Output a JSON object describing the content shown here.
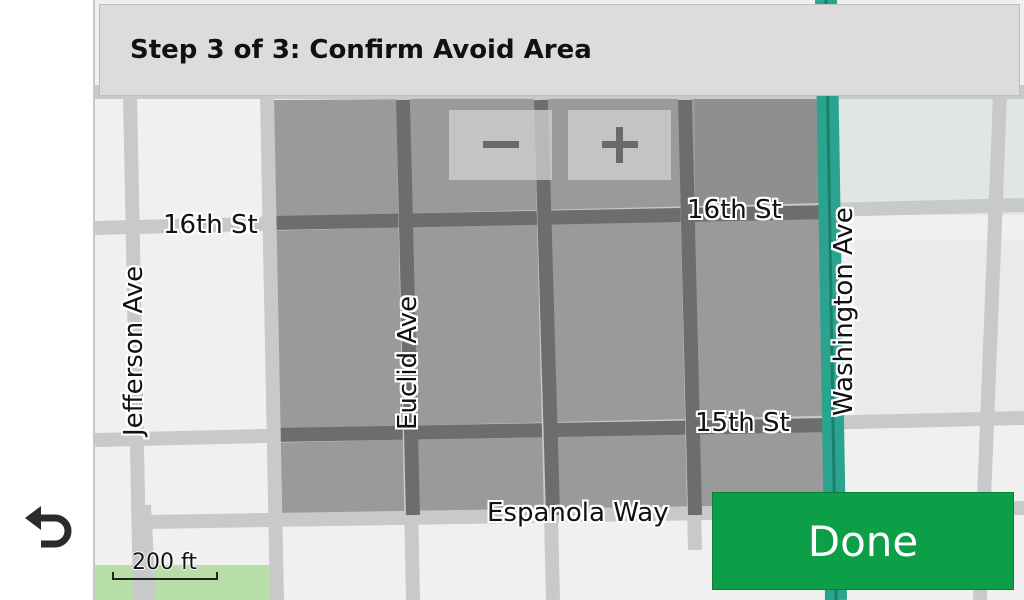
{
  "header": {
    "title": "Step 3 of 3: Confirm Avoid Area"
  },
  "map": {
    "streets": {
      "sixteenth_left": "16th St",
      "sixteenth_right": "16th St",
      "fifteenth": "15th St",
      "espanola": "Espanola Way",
      "jefferson": "Jefferson Ave",
      "euclid": "Euclid Ave",
      "washington": "Washington Ave"
    },
    "scale": "200 ft"
  },
  "controls": {
    "zoom_out_icon": "minus-icon",
    "zoom_in_icon": "plus-icon",
    "back_icon": "back-arrow-icon",
    "done_label": "Done"
  },
  "colors": {
    "done": "#0d9e48",
    "avoid_area": "#9a9a9a",
    "highway": "#2aa48e"
  }
}
